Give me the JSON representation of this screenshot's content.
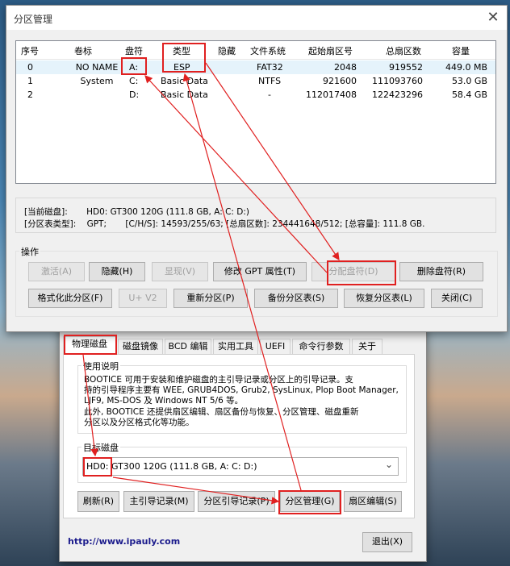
{
  "main_window": {
    "title": "分区管理",
    "close_icon": "close-icon",
    "columns": [
      "序号",
      "卷标",
      "盘符",
      "类型",
      "隐藏",
      "文件系统",
      "起始扇区号",
      "总扇区数",
      "容量"
    ],
    "rows": [
      {
        "no": "0",
        "label": "NO NAME",
        "drive": "A:",
        "type": "ESP",
        "hidden": "",
        "fs": "FAT32",
        "start": "2048",
        "total": "919552",
        "size": "449.0 MB"
      },
      {
        "no": "1",
        "label": "System",
        "drive": "C:",
        "type": "Basic Data",
        "hidden": "",
        "fs": "NTFS",
        "start": "921600",
        "total": "111093760",
        "size": "53.0 GB"
      },
      {
        "no": "2",
        "label": "",
        "drive": "D:",
        "type": "Basic Data",
        "hidden": "",
        "fs": "-",
        "start": "112017408",
        "total": "122423296",
        "size": "58.4 GB"
      }
    ],
    "info_line1": "[当前磁盘]:       HD0: GT300 120G (111.8 GB, A: C: D:)",
    "info_line2": "[分区表类型]:    GPT;       [C/H/S]: 14593/255/63; [总扇区数]: 234441648/512; [总容量]: 111.8 GB.",
    "ops_label": "操作",
    "buttons": {
      "activate": "激活(A)",
      "hide": "隐藏(H)",
      "show": "显现(V)",
      "modify_gpt": "修改 GPT 属性(T)",
      "assign_drive": "分配盘符(D)",
      "delete_drive": "删除盘符(R)",
      "format": "格式化此分区(F)",
      "uv2": "U+ V2",
      "repartition": "重新分区(P)",
      "backup": "备份分区表(S)",
      "restore": "恢复分区表(L)",
      "close": "关闭(C)"
    }
  },
  "bootice": {
    "tabs": [
      "物理磁盘",
      "磁盘镜像",
      "BCD 编辑",
      "实用工具",
      "UEFI",
      "命令行参数",
      "关于"
    ],
    "usage_label": "使用说明",
    "usage_text": [
      "BOOTICE 可用于安装和维护磁盘的主引导记录或分区上的引导记录。支",
      "持的引导程序主要有 WEE, GRUB4DOS, Grub2, SysLinux, Plop Boot Manager,",
      "LJF9, MS-DOS 及 Windows NT 5/6 等。",
      "此外, BOOTICE 还提供扇区编辑、扇区备份与恢复、分区管理、磁盘重新",
      "分区以及分区格式化等功能。"
    ],
    "target_label": "目标磁盘",
    "disk_select": "HD0: GT300 120G (111.8 GB, A: C: D:)",
    "buttons": {
      "refresh": "刷新(R)",
      "mbr": "主引导记录(M)",
      "pbr": "分区引导记录(P)",
      "partmgr": "分区管理(G)",
      "sector_edit": "扇区编辑(S)",
      "exit": "退出(X)"
    },
    "url": "http://www.ipauly.com"
  },
  "colors": {
    "annotation": "#e02020",
    "link": "#1a1a8c"
  }
}
